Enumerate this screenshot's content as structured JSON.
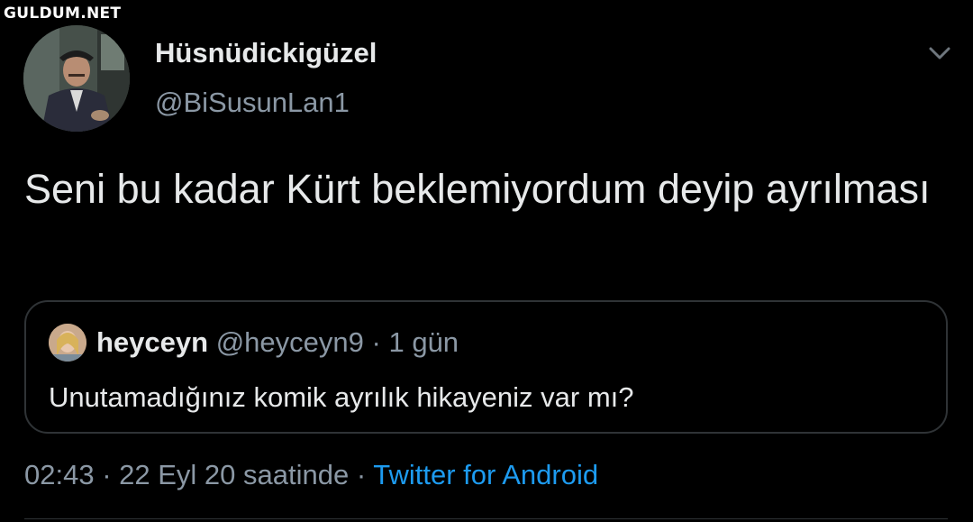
{
  "watermark": "GULDUM.NET",
  "author": {
    "display_name": "Hüsnüdickigüzel",
    "handle": "@BiSusunLan1"
  },
  "tweet": {
    "text": "Seni bu kadar Kürt beklemiyordum deyip ayrılması"
  },
  "quoted_tweet": {
    "display_name": "heyceyn",
    "handle": "@heyceyn9",
    "separator": "·",
    "time": "1 gün",
    "text": "Unutamadığınız komik ayrılık hikayeniz var mı?"
  },
  "meta": {
    "time": "02:43",
    "separator1": "·",
    "date": "22 Eyl 20 saatinde",
    "separator2": "·",
    "source": "Twitter for Android"
  },
  "colors": {
    "background": "#000000",
    "primary_text": "#e7e9ea",
    "secondary_text": "#8b98a5",
    "link": "#1d9bf0",
    "border": "#2f3336"
  },
  "icons": {
    "more": "chevron-down-icon"
  }
}
